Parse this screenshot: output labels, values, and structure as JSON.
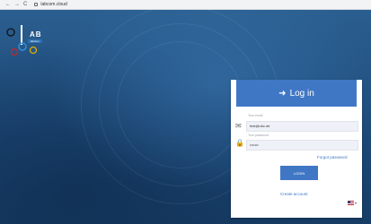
{
  "browser": {
    "back": "←",
    "forward": "→",
    "reload": "C",
    "url": "labcom.cloud"
  },
  "logo": {
    "text": "AB",
    "subtext": "labcom"
  },
  "login": {
    "title": "Log in",
    "email_label": "Your email",
    "email_value": "test@uhc.de",
    "password_label": "Your password",
    "password_value": "•••••••",
    "forgot_password": "Forgot password",
    "login_button": "LOGIN",
    "create_account": "Create account",
    "language": "EN"
  },
  "colors": {
    "brand": "#3f77c5",
    "background": "#1f4b78"
  }
}
